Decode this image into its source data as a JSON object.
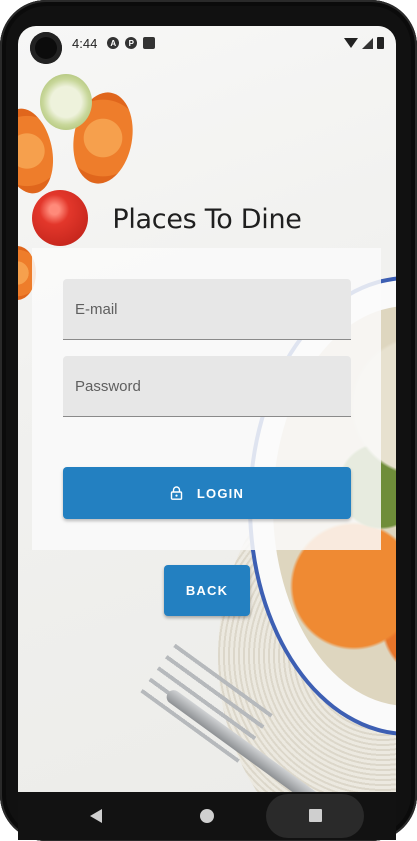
{
  "status_bar": {
    "time": "4:44",
    "left_icons": [
      "a-icon",
      "p-icon",
      "sd-card-icon"
    ],
    "right_icons": [
      "wifi-icon",
      "signal-icon",
      "battery-icon"
    ]
  },
  "page": {
    "title": "Places To Dine"
  },
  "login_form": {
    "email_placeholder": "E-mail",
    "email_value": "",
    "password_placeholder": "Password",
    "password_value": "",
    "login_label": "LOGIN",
    "login_icon": "lock-icon"
  },
  "back_button": {
    "label": "BACK"
  },
  "nav_bar": {
    "buttons": [
      "back",
      "home",
      "recents"
    ]
  },
  "colors": {
    "primary": "#2380c1",
    "field_bg": "#e7e7e7",
    "title_text": "#1f1f1f"
  }
}
